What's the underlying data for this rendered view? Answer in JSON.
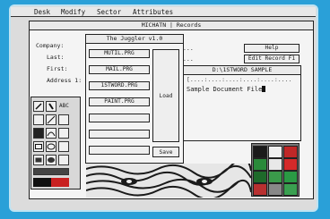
{
  "menu": [
    "Desk",
    "Modify",
    "Sector",
    "Attributes"
  ],
  "back_window": {
    "title": "MICHATN | Records",
    "fields": [
      "Company:",
      "Last:",
      "First:",
      "Address 1:"
    ],
    "help_button": "Help",
    "edit_button": "Edit Record F1",
    "dots": "..."
  },
  "juggler": {
    "title": "The Juggler v1.0",
    "programs": [
      "MUTIL.PRG",
      "MAIL.PRG",
      "1STWORD.PRG",
      "PAINT.PRG",
      "",
      "",
      "",
      ""
    ],
    "load_label": "Load",
    "save_label": "Save"
  },
  "doc_window": {
    "title": "D:\\1STWORD SAMPLE",
    "ruler": "[....:....:....:....:....:....",
    "text": "Sample Document File"
  },
  "tools": {
    "text_label": "ABC"
  },
  "palette": [
    "#1a1a1a",
    "#f0f0f0",
    "#c02828",
    "#2a8a3a",
    "#e8e8e8",
    "#d42a2a",
    "#1e6a2a",
    "#3a9a4a",
    "#2a9a44",
    "#b83030",
    "#888888",
    "#3aa050"
  ]
}
